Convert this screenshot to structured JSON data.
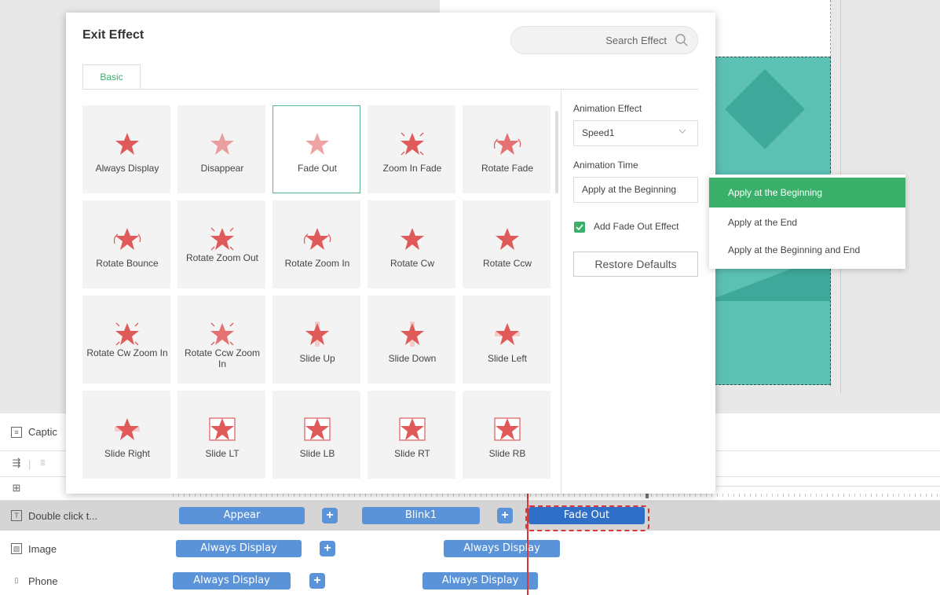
{
  "dialog": {
    "title": "Exit Effect",
    "search_placeholder": "Search Effect",
    "tab": "Basic",
    "effects": [
      {
        "label": "Always Display",
        "icon": "star-icon"
      },
      {
        "label": "Disappear",
        "icon": "star-faded-icon"
      },
      {
        "label": "Fade Out",
        "icon": "star-faded-icon"
      },
      {
        "label": "Zoom In Fade",
        "icon": "star-zoom-icon"
      },
      {
        "label": "Rotate Fade",
        "icon": "star-rotate-icon"
      },
      {
        "label": "Rotate Bounce",
        "icon": "star-rotate-bounce-icon"
      },
      {
        "label": "Rotate Zoom Out",
        "icon": "star-rotate-zoom-icon"
      },
      {
        "label": "Rotate Zoom In",
        "icon": "star-rotate-zoom-icon"
      },
      {
        "label": "Rotate Cw",
        "icon": "star-rotate-cw-icon"
      },
      {
        "label": "Rotate Ccw",
        "icon": "star-rotate-ccw-icon"
      },
      {
        "label": "Rotate Cw Zoom In",
        "icon": "star-rotate-cw-icon"
      },
      {
        "label": "Rotate Ccw Zoom In",
        "icon": "star-rotate-ccw-icon"
      },
      {
        "label": "Slide Up",
        "icon": "star-slide-up-icon"
      },
      {
        "label": "Slide Down",
        "icon": "star-slide-down-icon"
      },
      {
        "label": "Slide Left",
        "icon": "star-slide-left-icon"
      },
      {
        "label": "Slide Right",
        "icon": "star-slide-right-icon"
      },
      {
        "label": "Slide LT",
        "icon": "star-slide-lt-icon"
      },
      {
        "label": "Slide LB",
        "icon": "star-slide-lb-icon"
      },
      {
        "label": "Slide RT",
        "icon": "star-slide-rt-icon"
      },
      {
        "label": "Slide RB",
        "icon": "star-slide-rb-icon"
      }
    ],
    "selected_effect": "Fade Out",
    "settings": {
      "animation_effect_label": "Animation Effect",
      "animation_effect_value": "Speed1",
      "animation_time_label": "Animation Time",
      "animation_time_value": "Apply at the Beginning",
      "fade_checkbox_label": "Add Fade Out Effect",
      "fade_checked": true,
      "restore_label": "Restore Defaults"
    },
    "time_options": [
      "Apply at the Beginning",
      "Apply at the End",
      "Apply at the Beginning and End"
    ],
    "time_selected": "Apply at the Beginning"
  },
  "timeline": {
    "caption_label": "Captic",
    "tracks": [
      {
        "label": "Double click t...",
        "clips": [
          "Appear",
          "Blink1",
          "Fade Out"
        ]
      },
      {
        "label": "Image",
        "clips": [
          "Always Display",
          "Always Display"
        ]
      },
      {
        "label": "Phone",
        "clips": [
          "Always Display",
          "Always Display"
        ]
      }
    ]
  },
  "colors": {
    "accent_green": "#3aaf6a",
    "clip_blue": "#5b93d9",
    "clip_selected_blue": "#2f6fc7",
    "star_red": "#e05a5a",
    "canvas_teal": "#5cc1b3",
    "playhead_red": "#d9383a"
  }
}
